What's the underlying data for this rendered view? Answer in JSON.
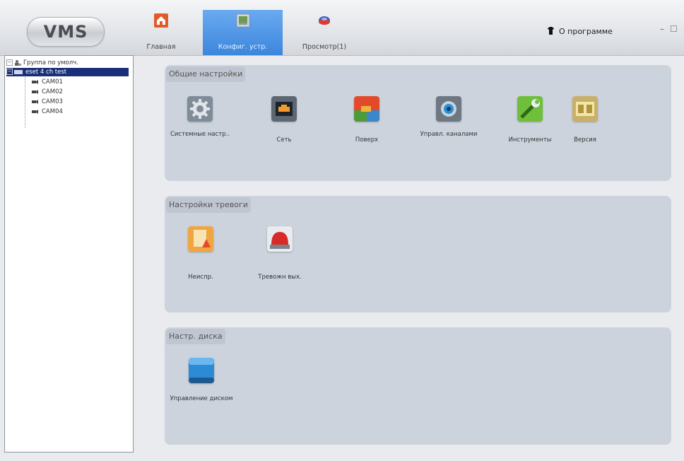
{
  "app": {
    "logo": "VMS",
    "nav": {
      "home": "Главная",
      "config": "Конфиг. устр.",
      "view": "Просмотр(1)"
    },
    "about": "О программе",
    "minimize": "–"
  },
  "tree": {
    "root": "Группа по умолч.",
    "device": "eset 4 ch test",
    "cameras": [
      "CAM01",
      "CAM02",
      "CAM03",
      "CAM04"
    ]
  },
  "sections": {
    "general": {
      "title": "Общие настройки",
      "tiles": [
        {
          "label": "Системные настр..",
          "icon": "gear-icon"
        },
        {
          "label": "Сеть",
          "icon": "network-icon"
        },
        {
          "label": "Поверх",
          "icon": "overlay-icon"
        },
        {
          "label": "Управл. каналами",
          "icon": "channel-icon"
        },
        {
          "label": "Инструменты",
          "icon": "tools-icon"
        },
        {
          "label": "Версия",
          "icon": "version-icon"
        }
      ]
    },
    "alarm": {
      "title": "Настройки тревоги",
      "tiles": [
        {
          "label": "Неиспр.",
          "icon": "fault-icon"
        },
        {
          "label": "Тревожн вых.",
          "icon": "alarm-light-icon"
        }
      ]
    },
    "disk": {
      "title": "Настр. диска",
      "tiles": [
        {
          "label": "Управление диском",
          "icon": "disk-icon"
        }
      ]
    }
  },
  "colors": {
    "active_tab": "#4a92e4",
    "section_bg": "#cdd3dd",
    "tree_selected": "#1a2f7a"
  }
}
